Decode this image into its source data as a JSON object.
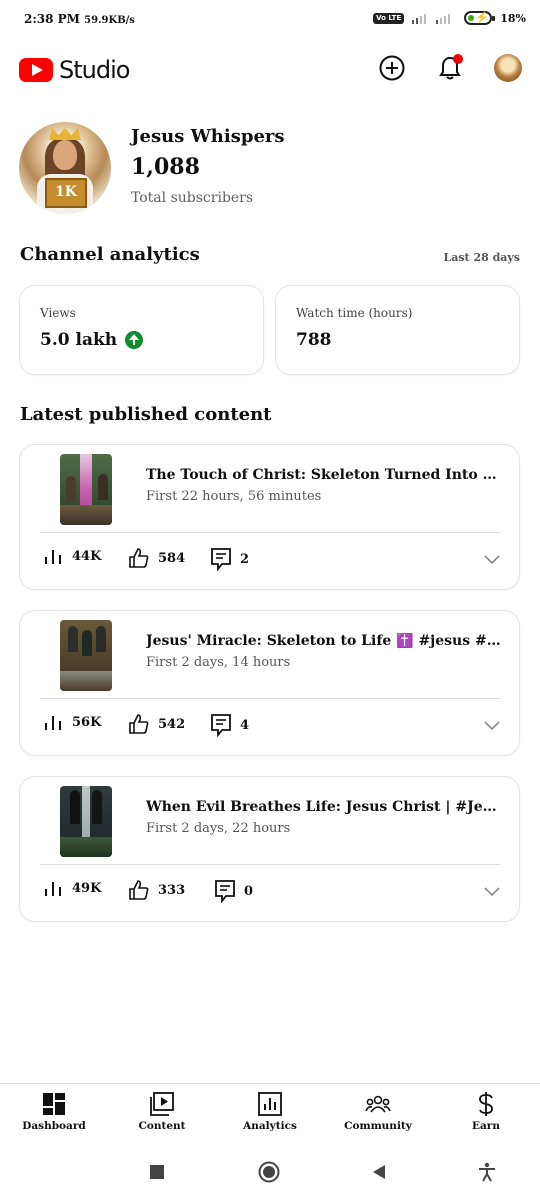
{
  "status_bar": {
    "time": "2:38 PM",
    "net_speed": "59.9KB/s",
    "volte": "Vo LTE",
    "battery": "18%"
  },
  "app_bar": {
    "logo_text": "Studio",
    "brand_color": "#ff0000",
    "notification_dot_color": "#e00000"
  },
  "channel": {
    "name": "Jesus Whispers",
    "subscribers": "1,088",
    "subscribers_label": "Total subscribers",
    "avatar_badge": "1K"
  },
  "analytics": {
    "title": "Channel analytics",
    "range": "Last 28 days",
    "metrics": [
      {
        "label": "Views",
        "value": "5.0 lakh",
        "trend": "up",
        "trend_color": "#118b2e"
      },
      {
        "label": "Watch time (hours)",
        "value": "788"
      }
    ]
  },
  "latest": {
    "title": "Latest published content",
    "items": [
      {
        "title": "The Touch of Christ: Skeleton Turned Into Life | #Christ...",
        "age": "First 22 hours, 56 minutes",
        "views": "44K",
        "likes": "584",
        "comments": "2"
      },
      {
        "title": "Jesus' Miracle: Skeleton to Life ✝️ #jesus #jesuschrist ...",
        "age": "First 2 days, 14 hours",
        "views": "56K",
        "likes": "542",
        "comments": "4"
      },
      {
        "title": "When Evil Breathes Life: Jesus Christ | #Jesus #Faith #g...",
        "age": "First 2 days, 22 hours",
        "views": "49K",
        "likes": "333",
        "comments": "0"
      }
    ]
  },
  "bottom_nav": {
    "items": [
      {
        "label": "Dashboard",
        "icon": "dashboard-icon",
        "selected": true
      },
      {
        "label": "Content",
        "icon": "content-icon"
      },
      {
        "label": "Analytics",
        "icon": "analytics-icon"
      },
      {
        "label": "Community",
        "icon": "community-icon"
      },
      {
        "label": "Earn",
        "icon": "dollar-icon"
      }
    ]
  }
}
